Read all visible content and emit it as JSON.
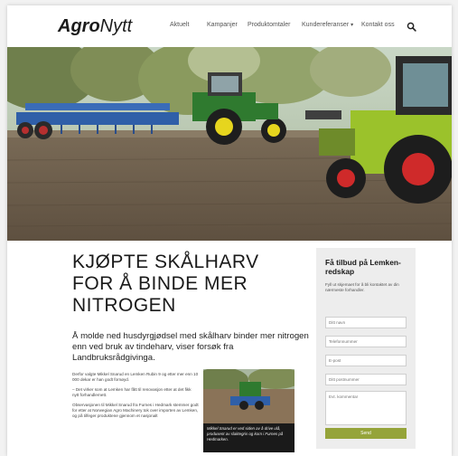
{
  "header": {
    "logo_bold": "Agro",
    "logo_light": "Nytt",
    "nav": [
      {
        "label": "Aktuelt"
      },
      {
        "label": "Kampanjer"
      },
      {
        "label": "Produktomtaler"
      },
      {
        "label": "Kundereferanser"
      },
      {
        "label": "Kontakt oss"
      }
    ],
    "dropdown_icon": "chevron-down-icon",
    "search_icon": "search-icon"
  },
  "article": {
    "title_lines": [
      "KJØPTE SKÅLHARV",
      "FOR Å BINDE MER",
      "NITROGEN"
    ],
    "lead": "Å molde ned husdyrgjødsel med skålharv binder mer nitrogen enn ved bruk av tindeharv, viser forsøk fra Landbruksrådgivinga.",
    "paragraphs": [
      "Derfor valgte Mikkel Snarud en Lemken Rubin 9 og etter mer enn 10 000 dekar er han godt fornøyd.",
      "– Det virker som at Lemken har fått til renovasjon etter at det fikk nytt forhandlernett.",
      "Observasjonen til Mikkel Snarud fra Furnes i Hedmark stemmer godt for etter at Norwegian Agro Machinery tok over importen av Lemken, og på tilfeger produktene gjennom et nasjonalt"
    ],
    "photo_caption": "Mikkel Snarud er ved siden av å drive ulå, produsent av slaktegris og korn i Furnes på Hedmarken."
  },
  "form": {
    "title": "Få tilbud på Lemken-redskap",
    "description": "Fyll ut skjemaet for å bli kontaktet av din nærmeste forhandler.",
    "placeholders": {
      "name": "Ditt navn",
      "phone": "Telefonnummer",
      "email": "E-post",
      "postal": "Ditt postnummer",
      "comments": "Evt. kommentar"
    },
    "submit_label": "Send"
  },
  "colors": {
    "accent_green": "#95a43a",
    "form_bg": "#ededed"
  }
}
